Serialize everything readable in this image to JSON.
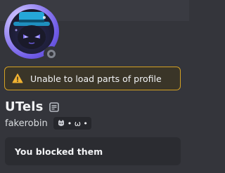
{
  "profile": {
    "warning_text": "Unable to load parts of profile",
    "display_name": "UTels",
    "username": "fakerobin",
    "clan_tag": "• ω •",
    "blocked_text": "You blocked them",
    "status": "offline"
  },
  "colors": {
    "warning_border": "#d4a123",
    "background": "#34353b",
    "card": "#2b2c31"
  },
  "icons": {
    "warning": "warning-triangle-icon",
    "note": "note-icon",
    "clan_badge": "clan-badge-icon",
    "status": "status-offline-icon"
  }
}
